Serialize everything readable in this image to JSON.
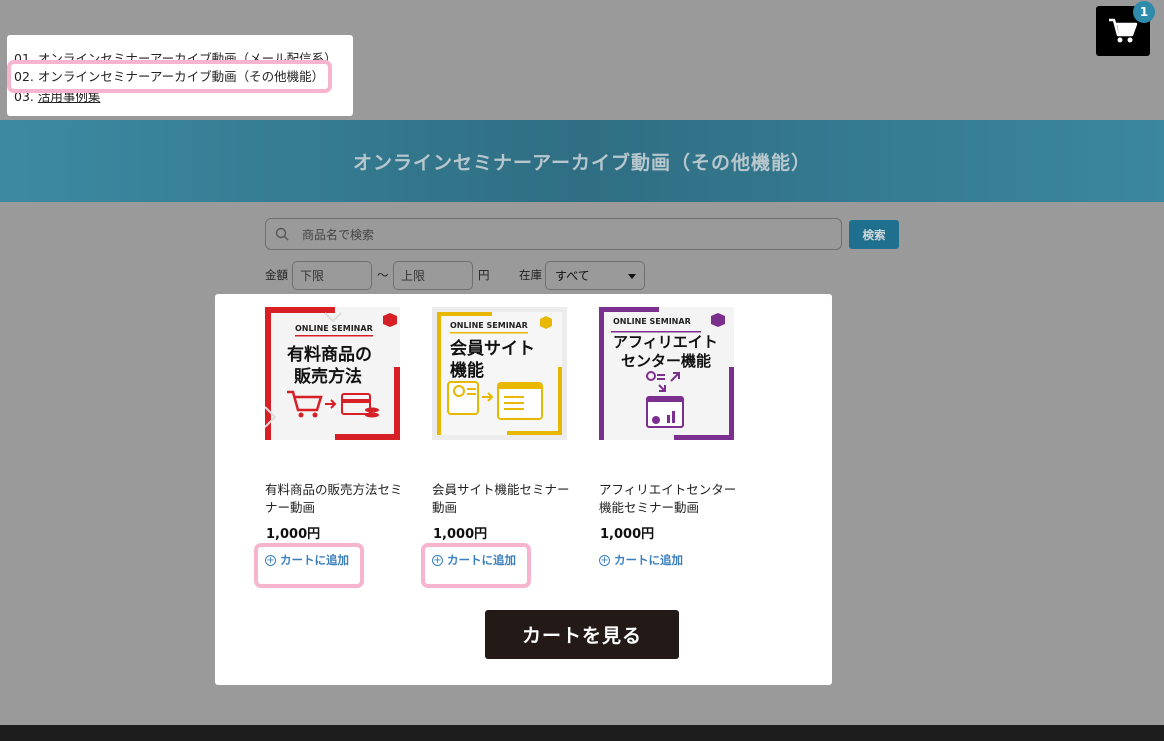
{
  "category_menu": {
    "items": [
      {
        "prefix": "01.",
        "label": "オンラインセミナーアーカイブ動画（メール配信系）"
      },
      {
        "prefix": "02.",
        "label": "オンラインセミナーアーカイブ動画（その他機能）"
      },
      {
        "prefix": "03.",
        "label": "活用事例集"
      }
    ]
  },
  "cart": {
    "count": "1"
  },
  "banner": {
    "title": "オンラインセミナーアーカイブ動画（その他機能）"
  },
  "search": {
    "placeholder": "商品名で検索",
    "button_label": "検索",
    "price_label": "金額",
    "min_placeholder": "下限",
    "range_sep": "～",
    "max_placeholder": "上限",
    "currency": "円",
    "stock_label": "在庫",
    "stock_value": "すべて"
  },
  "modal": {
    "products": [
      {
        "name": "有料商品の販売方法セミナー動画",
        "price": "1,000円",
        "add_label": "カートに追加",
        "thumb_tag": "ONLINE SEMINAR",
        "thumb_title_1": "有料商品の",
        "thumb_title_2": "販売方法",
        "accent": "#d71f26"
      },
      {
        "name": "会員サイト機能セミナー動画",
        "price": "1,000円",
        "add_label": "カートに追加",
        "thumb_tag": "ONLINE SEMINAR",
        "thumb_title_1": "会員サイト",
        "thumb_title_2": "機能",
        "accent": "#e8b800"
      },
      {
        "name": "アフィリエイトセンター機能セミナー動画",
        "price": "1,000円",
        "add_label": "カートに追加",
        "thumb_tag": "ONLINE SEMINAR",
        "thumb_title_1": "アフィリエイト",
        "thumb_title_2": "センター機能",
        "accent": "#7b2f8e"
      }
    ],
    "view_cart_label": "カートを見る"
  },
  "colors": {
    "overlay": "#9a9a9a",
    "highlight": "#f7b4cf",
    "link": "#3a7fbf",
    "banner": "#2f6e83",
    "button_dark": "#231a18"
  }
}
